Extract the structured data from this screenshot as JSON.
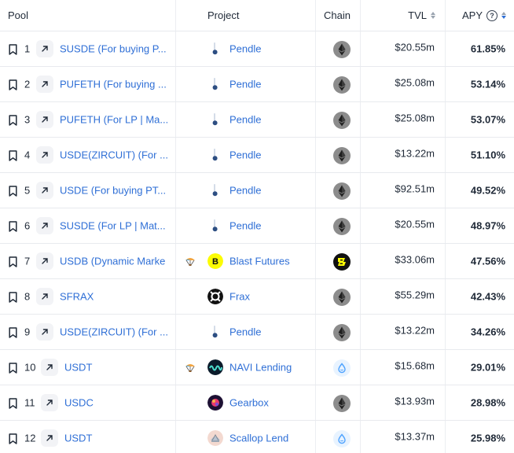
{
  "header": {
    "pool": "Pool",
    "project": "Project",
    "chain": "Chain",
    "tvl": "TVL",
    "apy": "APY",
    "help_glyph": "?"
  },
  "colors": {
    "link": "#2f6fd6",
    "ethereum_bg": "#8c8c8c",
    "sui_bg": "#e8f3ff",
    "blast_yellow": "#fcfc03"
  },
  "rows": [
    {
      "rank": "1",
      "pool": "SUSDE (For buying P...",
      "airdrop": false,
      "project": "Pendle",
      "project_icon": "pendle-logo-icon",
      "chain_icon": "ethereum-icon",
      "tvl": "$20.55m",
      "apy": "61.85%"
    },
    {
      "rank": "2",
      "pool": "PUFETH (For buying ...",
      "airdrop": false,
      "project": "Pendle",
      "project_icon": "pendle-logo-icon",
      "chain_icon": "ethereum-icon",
      "tvl": "$25.08m",
      "apy": "53.14%"
    },
    {
      "rank": "3",
      "pool": "PUFETH (For LP | Ma...",
      "airdrop": false,
      "project": "Pendle",
      "project_icon": "pendle-logo-icon",
      "chain_icon": "ethereum-icon",
      "tvl": "$25.08m",
      "apy": "53.07%"
    },
    {
      "rank": "4",
      "pool": "USDE(ZIRCUIT) (For ...",
      "airdrop": false,
      "project": "Pendle",
      "project_icon": "pendle-logo-icon",
      "chain_icon": "ethereum-icon",
      "tvl": "$13.22m",
      "apy": "51.10%"
    },
    {
      "rank": "5",
      "pool": "USDE (For buying PT...",
      "airdrop": false,
      "project": "Pendle",
      "project_icon": "pendle-logo-icon",
      "chain_icon": "ethereum-icon",
      "tvl": "$92.51m",
      "apy": "49.52%"
    },
    {
      "rank": "6",
      "pool": "SUSDE (For LP | Mat...",
      "airdrop": false,
      "project": "Pendle",
      "project_icon": "pendle-logo-icon",
      "chain_icon": "ethereum-icon",
      "tvl": "$20.55m",
      "apy": "48.97%"
    },
    {
      "rank": "7",
      "pool": "USDB (Dynamic Marke",
      "airdrop": true,
      "project": "Blast Futures",
      "project_icon": "blast-futures-logo-icon",
      "chain_icon": "blast-icon",
      "tvl": "$33.06m",
      "apy": "47.56%"
    },
    {
      "rank": "8",
      "pool": "SFRAX",
      "airdrop": false,
      "project": "Frax",
      "project_icon": "frax-logo-icon",
      "chain_icon": "ethereum-icon",
      "tvl": "$55.29m",
      "apy": "42.43%"
    },
    {
      "rank": "9",
      "pool": "USDE(ZIRCUIT) (For ...",
      "airdrop": false,
      "project": "Pendle",
      "project_icon": "pendle-logo-icon",
      "chain_icon": "ethereum-icon",
      "tvl": "$13.22m",
      "apy": "34.26%"
    },
    {
      "rank": "10",
      "pool": "USDT",
      "airdrop": true,
      "project": "NAVI Lending",
      "project_icon": "navi-logo-icon",
      "chain_icon": "sui-icon",
      "tvl": "$15.68m",
      "apy": "29.01%"
    },
    {
      "rank": "11",
      "pool": "USDC",
      "airdrop": false,
      "project": "Gearbox",
      "project_icon": "gearbox-logo-icon",
      "chain_icon": "ethereum-icon",
      "tvl": "$13.93m",
      "apy": "28.98%"
    },
    {
      "rank": "12",
      "pool": "USDT",
      "airdrop": false,
      "project": "Scallop Lend",
      "project_icon": "scallop-logo-icon",
      "chain_icon": "sui-icon",
      "tvl": "$13.37m",
      "apy": "25.98%"
    }
  ]
}
